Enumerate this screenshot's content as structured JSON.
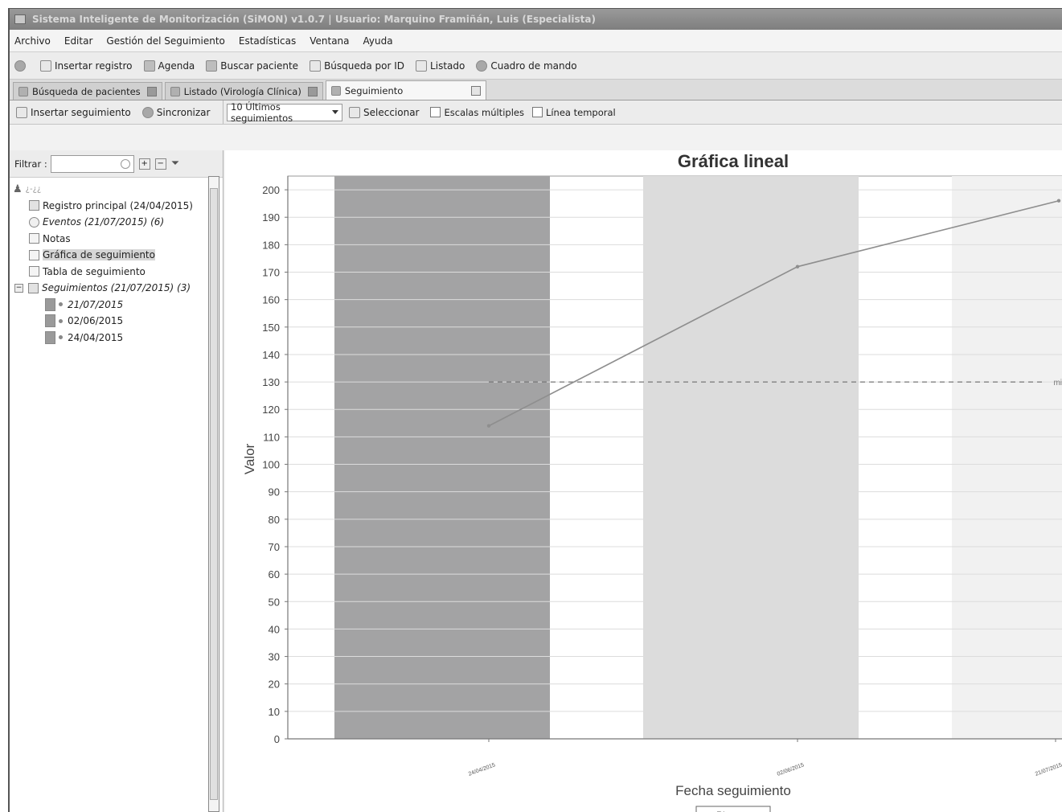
{
  "window": {
    "title": "Sistema Inteligente de Monitorización (SiMON) v1.0.7 | Usuario: Marquino Framiñán, Luis (Especialista)"
  },
  "menu": [
    "Archivo",
    "Editar",
    "Gestión del Seguimiento",
    "Estadísticas",
    "Ventana",
    "Ayuda"
  ],
  "toolbar": {
    "insertar_registro": "Insertar registro",
    "agenda": "Agenda",
    "buscar_paciente": "Buscar paciente",
    "busqueda_id": "Búsqueda por ID",
    "listado": "Listado",
    "cuadro_mando": "Cuadro de mando"
  },
  "tabs": [
    {
      "label": "Búsqueda de pacientes"
    },
    {
      "label": "Listado (Virología Clínica)"
    },
    {
      "label": "Seguimiento"
    }
  ],
  "subbar": {
    "insertar_seguimiento": "Insertar seguimiento",
    "sincronizar": "Sincronizar",
    "combo_value": "10 Últimos seguimientos",
    "seleccionar": "Seleccionar",
    "escalas": "Escalas múltiples",
    "linea_temporal": "Línea temporal"
  },
  "filter": {
    "label": "Filtrar :"
  },
  "tree": {
    "root": "¿-¿¿",
    "registro": "Registro principal (24/04/2015)",
    "eventos": "Eventos (21/07/2015) (6)",
    "notas": "Notas",
    "grafica": "Gráfica de seguimiento",
    "tabla": "Tabla de seguimiento",
    "seguimientos": "Seguimientos (21/07/2015) (3)",
    "items": [
      "21/07/2015",
      "02/06/2015",
      "24/04/2015"
    ]
  },
  "chart_data": {
    "type": "line",
    "title": "Gráfica lineal",
    "xlabel": "Fecha seguimiento",
    "ylabel": "Valor",
    "x": [
      "24/04/2015",
      "02/06/2015",
      "21/07/2015"
    ],
    "series": [
      {
        "name": "Plaquetas",
        "values": [
          114,
          172,
          196
        ]
      }
    ],
    "threshold": {
      "value": 130,
      "label": "mi"
    },
    "ylim": [
      0,
      205
    ],
    "yticks": [
      0,
      10,
      20,
      30,
      40,
      50,
      60,
      70,
      80,
      90,
      100,
      110,
      120,
      130,
      140,
      150,
      160,
      170,
      180,
      190,
      200
    ],
    "legend": "bottom",
    "grid": true
  }
}
